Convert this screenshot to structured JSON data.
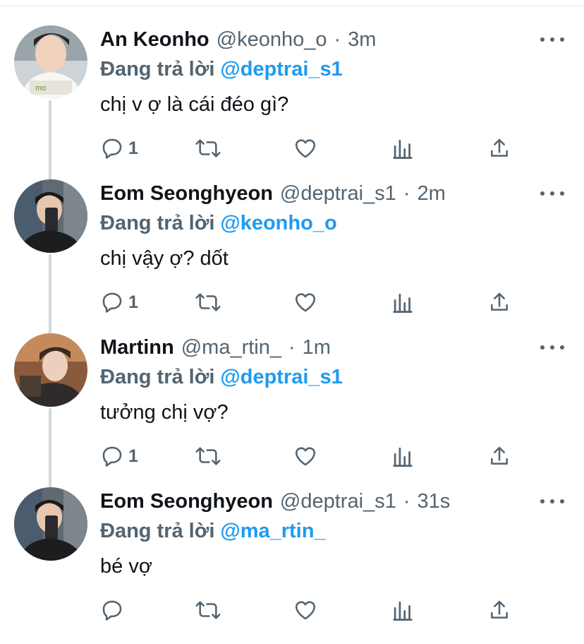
{
  "reply_prefix": "Đang trả lời",
  "colors": {
    "mention": "#1d9bf0",
    "secondary": "#536471",
    "thread_line": "#cfd9de"
  },
  "tweets": [
    {
      "name": "An Keonho",
      "handle": "@keonho_o",
      "separator": "·",
      "time": "3m",
      "reply_to": "@deptrai_s1",
      "text": "chị v ợ là cái đéo gì?",
      "reply_count": "1"
    },
    {
      "name": "Eom Seonghyeon",
      "handle": "@deptrai_s1",
      "separator": "·",
      "time": "2m",
      "reply_to": "@keonho_o",
      "text": "chị vậy ợ? dốt",
      "reply_count": "1"
    },
    {
      "name": "Martinn",
      "handle": "@ma_rtin_",
      "separator": "·",
      "time": "1m",
      "reply_to": "@deptrai_s1",
      "text": "tưởng chị vợ?",
      "reply_count": "1"
    },
    {
      "name": "Eom Seonghyeon",
      "handle": "@deptrai_s1",
      "separator": "·",
      "time": "31s",
      "reply_to": "@ma_rtin_",
      "text": "bé vợ",
      "reply_count": ""
    }
  ],
  "icons": {
    "reply": "reply-icon",
    "retweet": "retweet-icon",
    "like": "heart-icon",
    "analytics": "analytics-icon",
    "share": "share-icon",
    "more": "more-icon"
  }
}
